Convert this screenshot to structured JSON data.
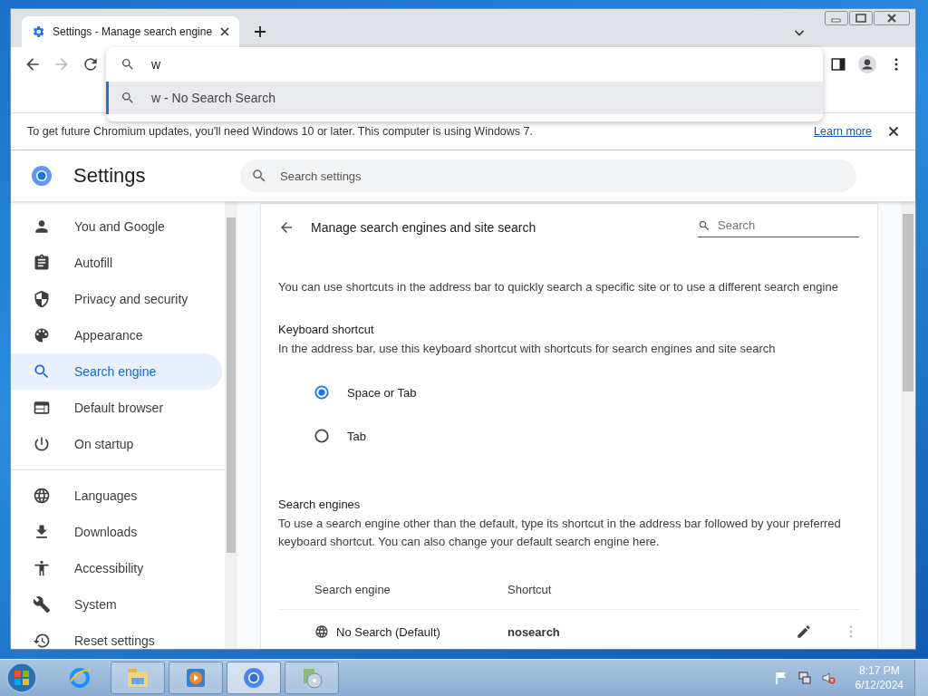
{
  "browser": {
    "tab_title": "Settings - Manage search engine"
  },
  "omnibox": {
    "value": "w",
    "suggestions": [
      {
        "text": "w - No Search Search",
        "selected": true
      }
    ]
  },
  "infobar": {
    "message": "To get future Chromium updates, you'll need Windows 10 or later. This computer is using Windows 7.",
    "link": "Learn more"
  },
  "settings": {
    "title": "Settings",
    "search_placeholder": "Search settings"
  },
  "sidebar": {
    "groups": [
      [
        {
          "label": "You and Google",
          "selected": false
        },
        {
          "label": "Autofill",
          "selected": false
        },
        {
          "label": "Privacy and security",
          "selected": false
        },
        {
          "label": "Appearance",
          "selected": false
        },
        {
          "label": "Search engine",
          "selected": true
        },
        {
          "label": "Default browser",
          "selected": false
        },
        {
          "label": "On startup",
          "selected": false
        }
      ],
      [
        {
          "label": "Languages",
          "selected": false
        },
        {
          "label": "Downloads",
          "selected": false
        },
        {
          "label": "Accessibility",
          "selected": false
        },
        {
          "label": "System",
          "selected": false
        },
        {
          "label": "Reset settings",
          "selected": false
        }
      ]
    ]
  },
  "page": {
    "title": "Manage search engines and site search",
    "search_placeholder": "Search",
    "intro": "You can use shortcuts in the address bar to quickly search a specific site or to use a different search engine",
    "keyboard_shortcut": {
      "heading": "Keyboard shortcut",
      "description": "In the address bar, use this keyboard shortcut with shortcuts for search engines and site search",
      "options": [
        {
          "label": "Space or Tab",
          "selected": true
        },
        {
          "label": "Tab",
          "selected": false
        }
      ]
    },
    "search_engines": {
      "heading": "Search engines",
      "description": "To use a search engine other than the default, type its shortcut in the address bar followed by your preferred keyboard shortcut. You can also change your default search engine here.",
      "columns": [
        "Search engine",
        "Shortcut"
      ],
      "rows": [
        {
          "name": "No Search (Default)",
          "shortcut": "nosearch"
        }
      ]
    }
  },
  "taskbar": {
    "apps": [
      {
        "running": false,
        "selected": false
      },
      {
        "running": true,
        "selected": false
      },
      {
        "running": true,
        "selected": false
      },
      {
        "running": true,
        "selected": true
      },
      {
        "running": true,
        "selected": false
      }
    ],
    "time": "8:17 PM",
    "date": "6/12/2024"
  }
}
